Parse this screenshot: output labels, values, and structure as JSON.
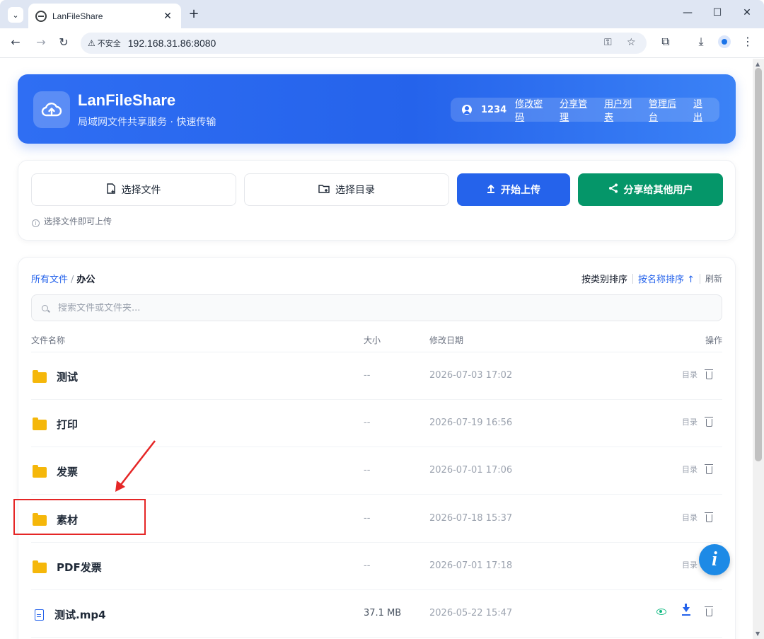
{
  "browser": {
    "tab_title": "LanFileShare",
    "security_label": "不安全",
    "url": "192.168.31.86:8080"
  },
  "header": {
    "title": "LanFileShare",
    "subtitle": "局域网文件共享服务 · 快速传输",
    "user_id": "1234",
    "links": [
      "修改密码",
      "分享管理",
      "用户列表",
      "管理后台",
      "退出"
    ]
  },
  "upload": {
    "choose_file": "选择文件",
    "choose_dir": "选择目录",
    "start_upload": "开始上传",
    "share": "分享给其他用户",
    "hint": "选择文件即可上传"
  },
  "breadcrumb": {
    "root": "所有文件",
    "separator": "/",
    "current": "办公"
  },
  "sort": {
    "by_type": "按类别排序",
    "by_name": "按名称排序 ↑",
    "refresh": "刷新"
  },
  "search": {
    "placeholder": "搜索文件或文件夹..."
  },
  "table": {
    "headers": {
      "name": "文件名称",
      "size": "大小",
      "date": "修改日期",
      "actions": "操作"
    },
    "rows": [
      {
        "name": "测试",
        "type": "folder",
        "size": "--",
        "date": "2026-07-03 17:02",
        "action": "目录"
      },
      {
        "name": "打印",
        "type": "folder",
        "size": "--",
        "date": "2026-07-19 16:56",
        "action": "目录"
      },
      {
        "name": "发票",
        "type": "folder",
        "size": "--",
        "date": "2026-07-01 17:06",
        "action": "目录"
      },
      {
        "name": "素材",
        "type": "folder",
        "size": "--",
        "date": "2026-07-18 15:37",
        "action": "目录"
      },
      {
        "name": "PDF发票",
        "type": "folder",
        "size": "--",
        "date": "2026-07-01 17:18",
        "action": "目录"
      },
      {
        "name": "测试.mp4",
        "type": "file",
        "size": "37.1 MB",
        "date": "2026-05-22 15:47",
        "action": ""
      }
    ]
  },
  "colors": {
    "primary": "#2563eb",
    "success": "#059669",
    "folder": "#f5b70a",
    "annotation": "#e52626",
    "fab": "#1d8ae6"
  },
  "icons": {
    "fab": "info-icon",
    "folder": "folder-icon",
    "file": "file-icon",
    "preview": "eye-icon",
    "download": "download-icon",
    "delete": "trash-icon"
  }
}
